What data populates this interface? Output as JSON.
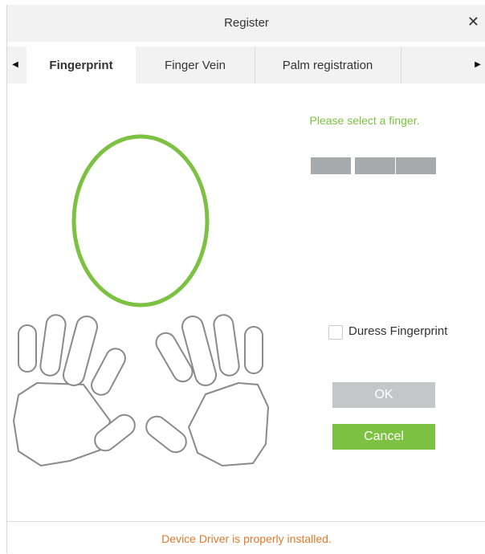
{
  "dialog": {
    "title": "Register",
    "close_glyph": "✕"
  },
  "tabs": {
    "scroll_left_glyph": "◀",
    "scroll_right_glyph": "▶",
    "items": [
      {
        "label": "Fingerprint",
        "active": true
      },
      {
        "label": "Finger Vein",
        "active": false
      },
      {
        "label": "Palm registration",
        "active": false
      }
    ]
  },
  "fingerprint": {
    "prompt": "Please select a finger.",
    "progress_slots": 3,
    "progress_filled": 0,
    "duress_label": "Duress Fingerprint",
    "duress_checked": false,
    "ok_label": "OK",
    "cancel_label": "Cancel"
  },
  "footer": {
    "status": "Device Driver is properly installed."
  },
  "colors": {
    "accent_green": "#7cc142",
    "status_orange": "#e2792c",
    "slot_gray": "#a6aaad",
    "disabled_button": "#c4c7c9"
  }
}
